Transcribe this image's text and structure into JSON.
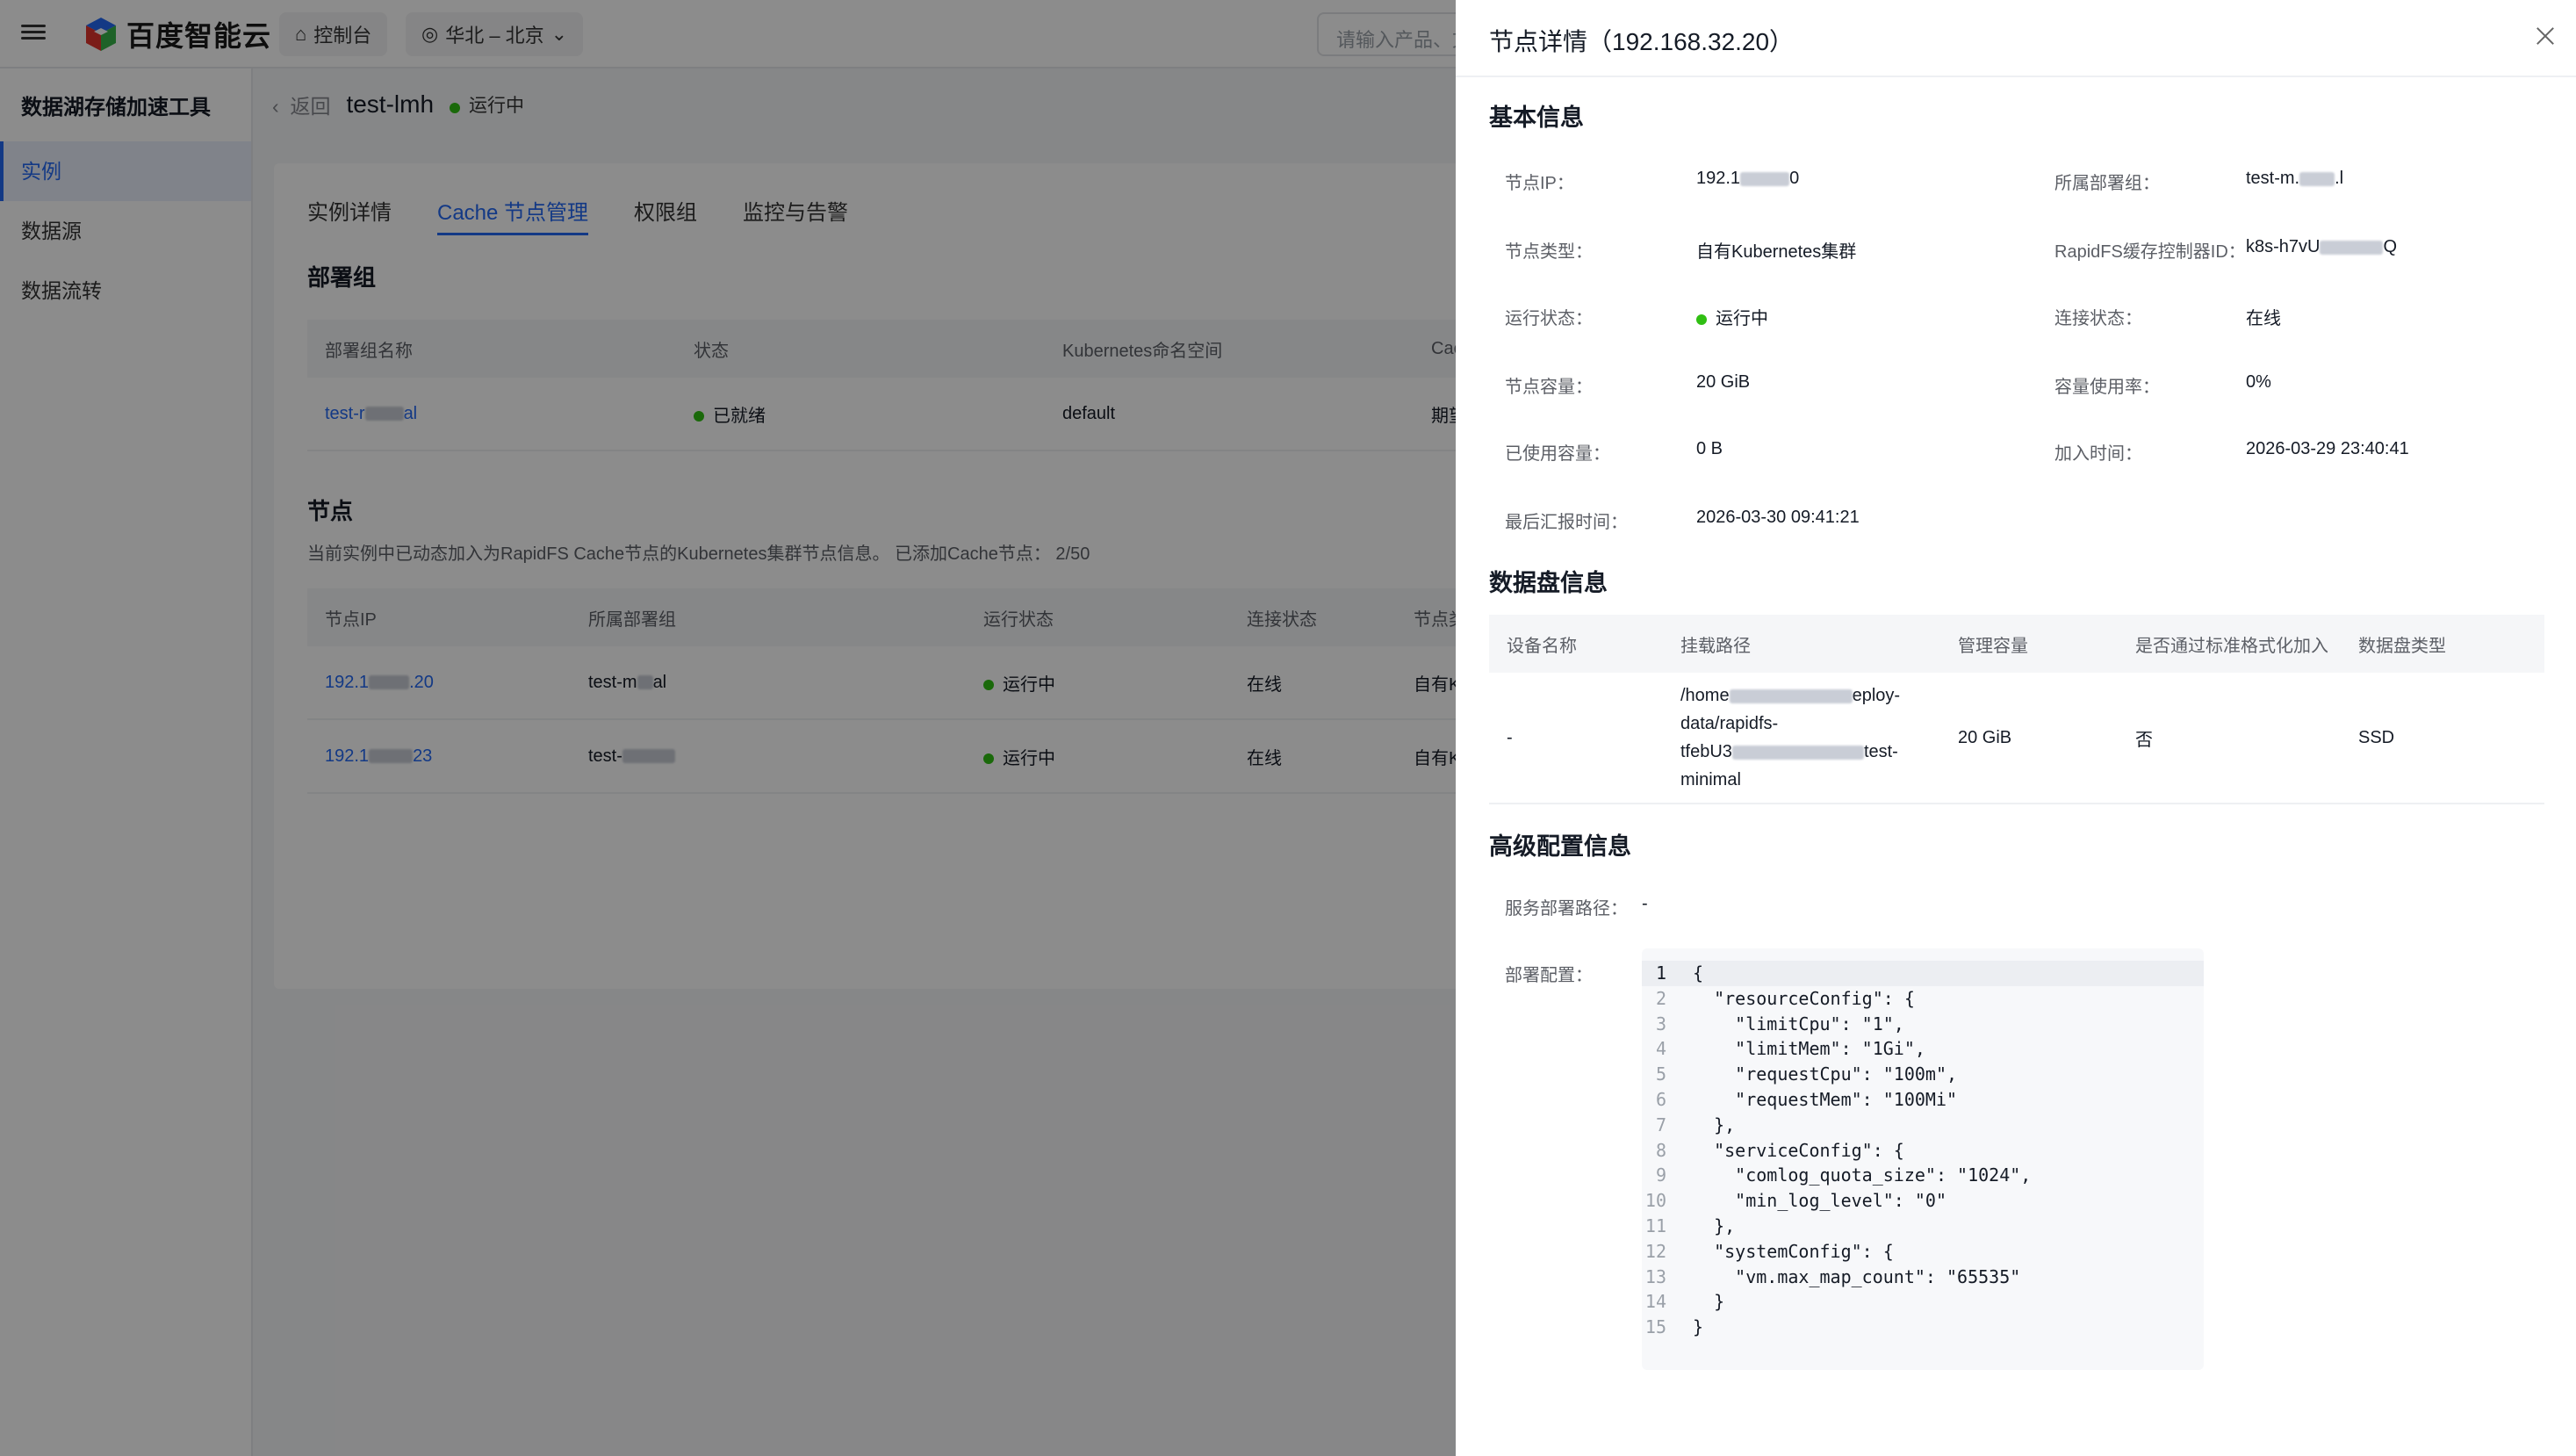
{
  "topbar": {
    "brand": "百度智能云",
    "console": "控制台",
    "region": "华北 – 北京",
    "search_placeholder": "请输入产品、文"
  },
  "sidebar": {
    "title": "数据湖存储加速工具",
    "items": [
      {
        "label": "实例"
      },
      {
        "label": "数据源"
      },
      {
        "label": "数据流转"
      }
    ]
  },
  "page": {
    "back": "返回",
    "instance_name": "test-lmh",
    "instance_status": "运行中",
    "tabs": [
      "实例详情",
      "Cache 节点管理",
      "权限组",
      "监控与告警"
    ],
    "deploy_section": "部署组",
    "deploy_headers": [
      "部署组名称",
      "状态",
      "Kubernetes命名空间",
      "Cac"
    ],
    "deploy_rows": [
      {
        "name": "test-r",
        "name_tail": "al",
        "status": "已就绪",
        "namespace": "default",
        "extra": "期望"
      }
    ],
    "node_section": "节点",
    "node_desc": "当前实例中已动态加入为RapidFS Cache节点的Kubernetes集群节点信息。 已添加Cache节点： 2/50",
    "node_headers": [
      "节点IP",
      "所属部署组",
      "运行状态",
      "连接状态",
      "节点类"
    ],
    "node_rows": [
      {
        "ip": "192.1",
        "ip_tail": ".20",
        "group": "test-m",
        "group_tail": "al",
        "status": "运行中",
        "conn": "在线",
        "type": "自有K"
      },
      {
        "ip": "192.1",
        "ip_tail": "23",
        "group": "test-",
        "group_tail": "",
        "status": "运行中",
        "conn": "在线",
        "type": "自有K"
      }
    ]
  },
  "drawer": {
    "title": "节点详情（192.168.32.20）",
    "basic": {
      "heading": "基本信息",
      "node_ip_label": "节点IP：",
      "node_ip": "192.1",
      "node_ip_tail": "0",
      "group_label": "所属部署组：",
      "group": "test-m.",
      "group_tail": ".l",
      "type_label": "节点类型：",
      "type": "自有Kubernetes集群",
      "ctrl_label": "RapidFS缓存控制器ID：",
      "ctrl": "k8s-h7vU",
      "ctrl_tail": "Q",
      "run_label": "运行状态：",
      "run": "运行中",
      "conn_label": "连接状态：",
      "conn": "在线",
      "cap_label": "节点容量：",
      "cap": "20 GiB",
      "usage_label": "容量使用率：",
      "usage": "0%",
      "used_label": "已使用容量：",
      "used": "0 B",
      "join_label": "加入时间：",
      "join": "2026-03-29 23:40:41",
      "report_label": "最后汇报时间：",
      "report": "2026-03-30 09:41:21"
    },
    "disk": {
      "heading": "数据盘信息",
      "headers": [
        "设备名称",
        "挂载路径",
        "管理容量",
        "是否通过标准格式化加入",
        "数据盘类型"
      ],
      "row": {
        "device": "-",
        "path_line1": "/home",
        "path_line1_tail": "eploy-",
        "path_line2": "data/rapidfs-",
        "path_line3": "tfebU3",
        "path_line3_tail": "test-",
        "path_line4": "minimal",
        "capacity": "20 GiB",
        "formatted": "否",
        "disk_type": "SSD"
      }
    },
    "advanced": {
      "heading": "高级配置信息",
      "service_path_label": "服务部署路径：",
      "service_path": "-",
      "deploy_config_label": "部署配置：",
      "code_lines": [
        "{",
        "  \"resourceConfig\": {",
        "    \"limitCpu\": \"1\",",
        "    \"limitMem\": \"1Gi\",",
        "    \"requestCpu\": \"100m\",",
        "    \"requestMem\": \"100Mi\"",
        "  },",
        "  \"serviceConfig\": {",
        "    \"comlog_quota_size\": \"1024\",",
        "    \"min_log_level\": \"0\"",
        "  },",
        "  \"systemConfig\": {",
        "    \"vm.max_map_count\": \"65535\"",
        "  }",
        "}"
      ]
    }
  }
}
